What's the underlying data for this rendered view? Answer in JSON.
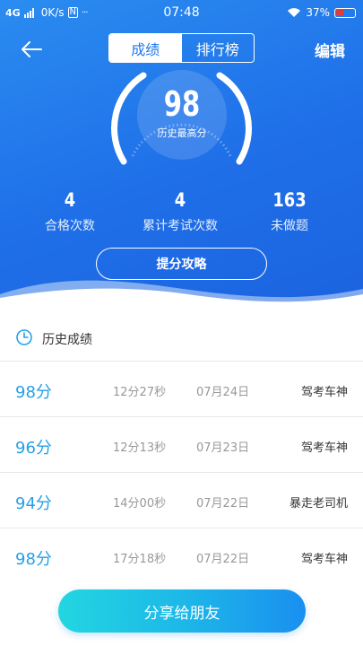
{
  "status_bar": {
    "network": "4G",
    "speed": "0K/s",
    "sim_icon": "N",
    "dots": "···",
    "time": "07:48",
    "battery": "37%"
  },
  "nav": {
    "tabs": [
      "成绩",
      "排行榜"
    ],
    "active_tab": 0,
    "edit_label": "编辑"
  },
  "gauge": {
    "score": "98",
    "label": "历史最高分"
  },
  "stats": [
    {
      "value": "4",
      "label": "合格次数"
    },
    {
      "value": "4",
      "label": "累计考试次数"
    },
    {
      "value": "163",
      "label": "未做题"
    }
  ],
  "tips_button": "提分攻略",
  "history": {
    "title": "历史成绩",
    "rows": [
      {
        "score": "98分",
        "time": "12分27秒",
        "date": "07月24日",
        "title": "驾考车神"
      },
      {
        "score": "96分",
        "time": "12分13秒",
        "date": "07月23日",
        "title": "驾考车神"
      },
      {
        "score": "94分",
        "time": "14分00秒",
        "date": "07月22日",
        "title": "暴走老司机"
      },
      {
        "score": "98分",
        "time": "17分18秒",
        "date": "07月22日",
        "title": "驾考车神"
      }
    ]
  },
  "share_button": "分享给朋友",
  "colors": {
    "header_blue": "#1f6fe8",
    "score_blue": "#24a0e8",
    "button_cyan": "#22d6e0"
  }
}
